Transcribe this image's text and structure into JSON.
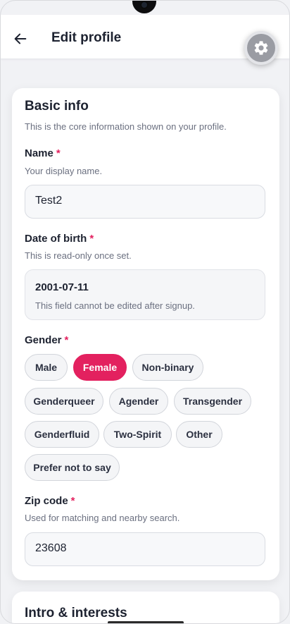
{
  "header": {
    "title": "Edit profile"
  },
  "basic_info": {
    "title": "Basic info",
    "subtitle": "This is the core information shown on your profile.",
    "name": {
      "label": "Name",
      "required_mark": "*",
      "help": "Your display name.",
      "value": "Test2"
    },
    "dob": {
      "label": "Date of birth",
      "required_mark": "*",
      "help": "This is read-only once set.",
      "value": "2001-07-11",
      "note": "This field cannot be edited after signup."
    },
    "gender": {
      "label": "Gender",
      "required_mark": "*",
      "options": [
        "Male",
        "Female",
        "Non-binary",
        "Genderqueer",
        "Agender",
        "Transgender",
        "Genderfluid",
        "Two-Spirit",
        "Other",
        "Prefer not to say"
      ],
      "selected": "Female"
    },
    "zip": {
      "label": "Zip code",
      "required_mark": "*",
      "help": "Used for matching and nearby search.",
      "value": "23608"
    }
  },
  "next_section": {
    "title": "Intro & interests"
  },
  "colors": {
    "accent": "#e3215f",
    "background": "#f1f2f5"
  },
  "icons": {
    "back": "arrow-left-icon",
    "settings": "gear-icon"
  }
}
